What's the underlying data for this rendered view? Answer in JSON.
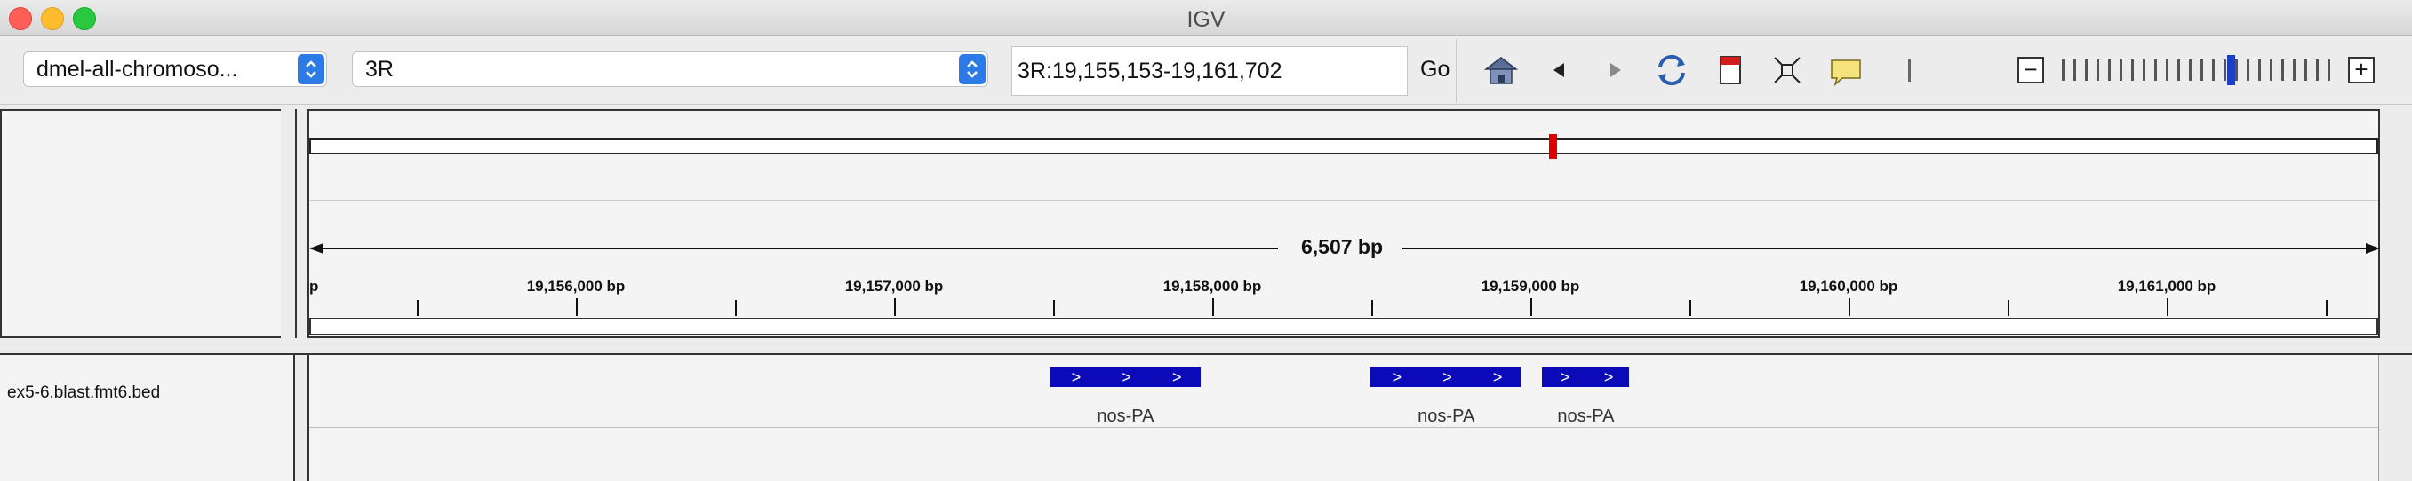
{
  "window": {
    "title": "IGV"
  },
  "toolbar": {
    "genome_select": "dmel-all-chromoso...",
    "chromosome_select": "3R",
    "locus_value": "3R:19,155,153-19,161,702",
    "go_label": "Go",
    "icons": [
      "home-icon",
      "back-icon",
      "forward-icon",
      "refresh-icon",
      "region-of-interest-icon",
      "fit-to-window-icon",
      "popup-info-icon"
    ],
    "zoom": {
      "minus_label": "−",
      "plus_label": "+",
      "level_fraction": 0.62
    }
  },
  "ideogram": {
    "current_position_fraction": 0.601
  },
  "ruler": {
    "span_label": "6,507 bp",
    "tick_labels": [
      "19,156,000 bp",
      "19,157,000 bp",
      "19,158,000 bp",
      "19,159,000 bp",
      "19,160,000 bp",
      "19,161,000 bp"
    ],
    "left_edge_label": "p"
  },
  "tracks": [
    {
      "name": "ex5-6.blast.fmt6.bed",
      "features": [
        {
          "label": "nos-PA",
          "start_fraction": 0.358,
          "end_fraction": 0.431,
          "strand": ">"
        },
        {
          "label": "nos-PA",
          "start_fraction": 0.513,
          "end_fraction": 0.586,
          "strand": ">"
        },
        {
          "label": "nos-PA",
          "start_fraction": 0.596,
          "end_fraction": 0.638,
          "strand": ">"
        }
      ]
    }
  ],
  "colors": {
    "feature": "#0a0ab8",
    "ideogram_marker": "#e00000",
    "zoom_cursor": "#1f3ec8"
  }
}
